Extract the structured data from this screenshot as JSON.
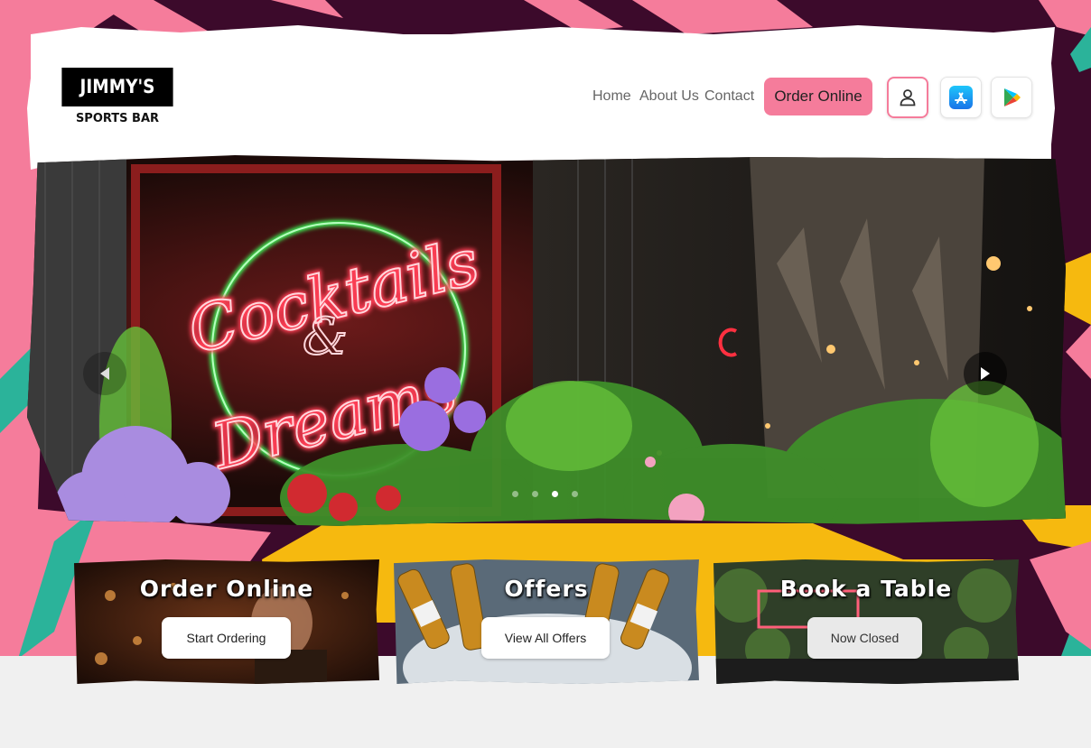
{
  "brand": {
    "name_top": "JIMMY'S",
    "name_bottom": "SPORTS BAR"
  },
  "nav": {
    "links": [
      "Home",
      "About Us",
      "Contact"
    ],
    "order_button": "Order Online",
    "icons": [
      "user-icon",
      "app-store-icon",
      "google-play-icon"
    ]
  },
  "hero": {
    "sign_line1": "Cocktails",
    "sign_line2": "&",
    "sign_line3": "Dreams",
    "slides_count": 4,
    "active_slide": 3
  },
  "cards": [
    {
      "title": "Order Online",
      "button": "Start Ordering",
      "disabled": false
    },
    {
      "title": "Offers",
      "button": "View All Offers",
      "disabled": false
    },
    {
      "title": "Book a Table",
      "button": "Now Closed",
      "disabled": true
    }
  ],
  "colors": {
    "pink": "#f57c9b",
    "plum": "#3c0a2b",
    "yellow": "#f6b90f",
    "teal": "#2bb39a"
  }
}
